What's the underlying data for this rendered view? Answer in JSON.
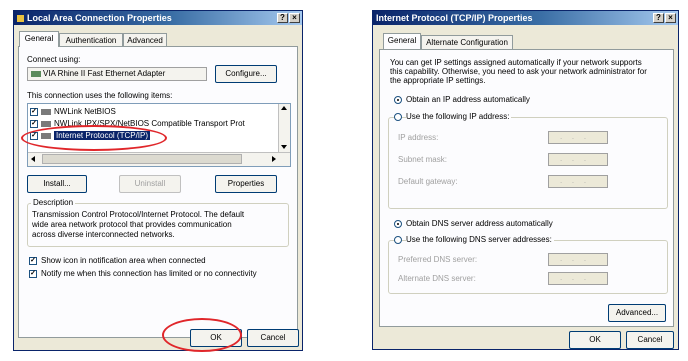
{
  "colors": {
    "title_bar": "#0a246a",
    "selection": "#0a246a",
    "highlight_oval": "#e0262a",
    "dialog_bg": "#ece9d8"
  },
  "left": {
    "title": "Local Area Connection Properties",
    "help_btn": "?",
    "close_btn": "×",
    "tabs": [
      "General",
      "Authentication",
      "Advanced"
    ],
    "connect_using_label": "Connect using:",
    "adapter_name": "VIA Rhine II Fast Ethernet Adapter",
    "configure_label": "Configure...",
    "items_label": "This connection uses the following items:",
    "items": [
      "NWLink NetBIOS",
      "NWLink IPX/SPX/NetBIOS Compatible Transport Prot",
      "Internet Protocol (TCP/IP)"
    ],
    "install_label": "Install...",
    "uninstall_label": "Uninstall",
    "properties_label": "Properties",
    "description_label": "Description",
    "description_text": [
      "Transmission Control Protocol/Internet Protocol. The default",
      "wide area network protocol that provides communication",
      "across diverse interconnected networks."
    ],
    "show_icon_label": "Show icon in notification area when connected",
    "notify_label": "Notify me when this connection has limited or no connectivity",
    "ok_label": "OK",
    "cancel_label": "Cancel"
  },
  "right": {
    "title": "Internet Protocol (TCP/IP) Properties",
    "help_btn": "?",
    "close_btn": "×",
    "tabs": [
      "General",
      "Alternate Configuration"
    ],
    "intro": [
      "You can get IP settings assigned automatically if your network supports",
      "this capability. Otherwise, you need to ask your network administrator for",
      "the appropriate IP settings."
    ],
    "obtain_ip_label": "Obtain an IP address automatically",
    "use_ip_label": "Use the following IP address:",
    "ip_address_label": "IP address:",
    "subnet_label": "Subnet mask:",
    "gateway_label": "Default gateway:",
    "obtain_dns_label": "Obtain DNS server address automatically",
    "use_dns_label": "Use the following DNS server addresses:",
    "preferred_dns_label": "Preferred DNS server:",
    "alternate_dns_label": "Alternate DNS server:",
    "ip_dots": "...",
    "advanced_label": "Advanced...",
    "ok_label": "OK",
    "cancel_label": "Cancel"
  }
}
